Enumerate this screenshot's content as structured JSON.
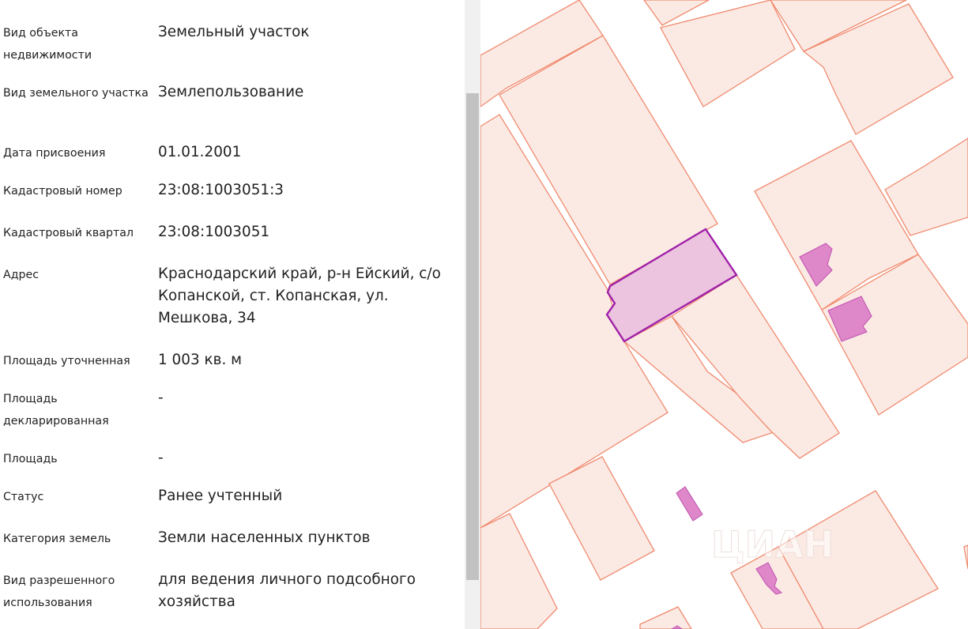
{
  "properties": [
    {
      "label": "Вид объекта недвижимости",
      "value": "Земельный участок"
    },
    {
      "label": "Вид земельного участка",
      "value": "Землепользование"
    },
    {
      "label": "Дата присвоения",
      "value": "01.01.2001"
    },
    {
      "label": "Кадастровый номер",
      "value": "23:08:1003051:3"
    },
    {
      "label": "Кадастровый квартал",
      "value": "23:08:1003051"
    },
    {
      "label": "Адрес",
      "value": "Краснодарский край, р-н Ейский, с/о Копанской, ст. Копанская, ул. Мешкова, 34"
    },
    {
      "label": "Площадь уточненная",
      "value": "1 003 кв. м"
    },
    {
      "label": "Площадь декларированная",
      "value": "-"
    },
    {
      "label": "Площадь",
      "value": "-"
    },
    {
      "label": "Статус",
      "value": "Ранее учтенный"
    },
    {
      "label": "Категория земель",
      "value": "Земли населенных пунктов"
    },
    {
      "label": "Вид разрешенного использования",
      "value": "для ведения личного подсобного хозяйства"
    }
  ],
  "map": {
    "parcel_fill": "#fbeae4",
    "parcel_stroke": "#f08a6e",
    "selected_fill": "#ecc4df",
    "selected_stroke": "#a020a8",
    "building_fill": "#de88c9",
    "building_stroke": "#c050b0",
    "watermark_text": "ЦИАН"
  }
}
